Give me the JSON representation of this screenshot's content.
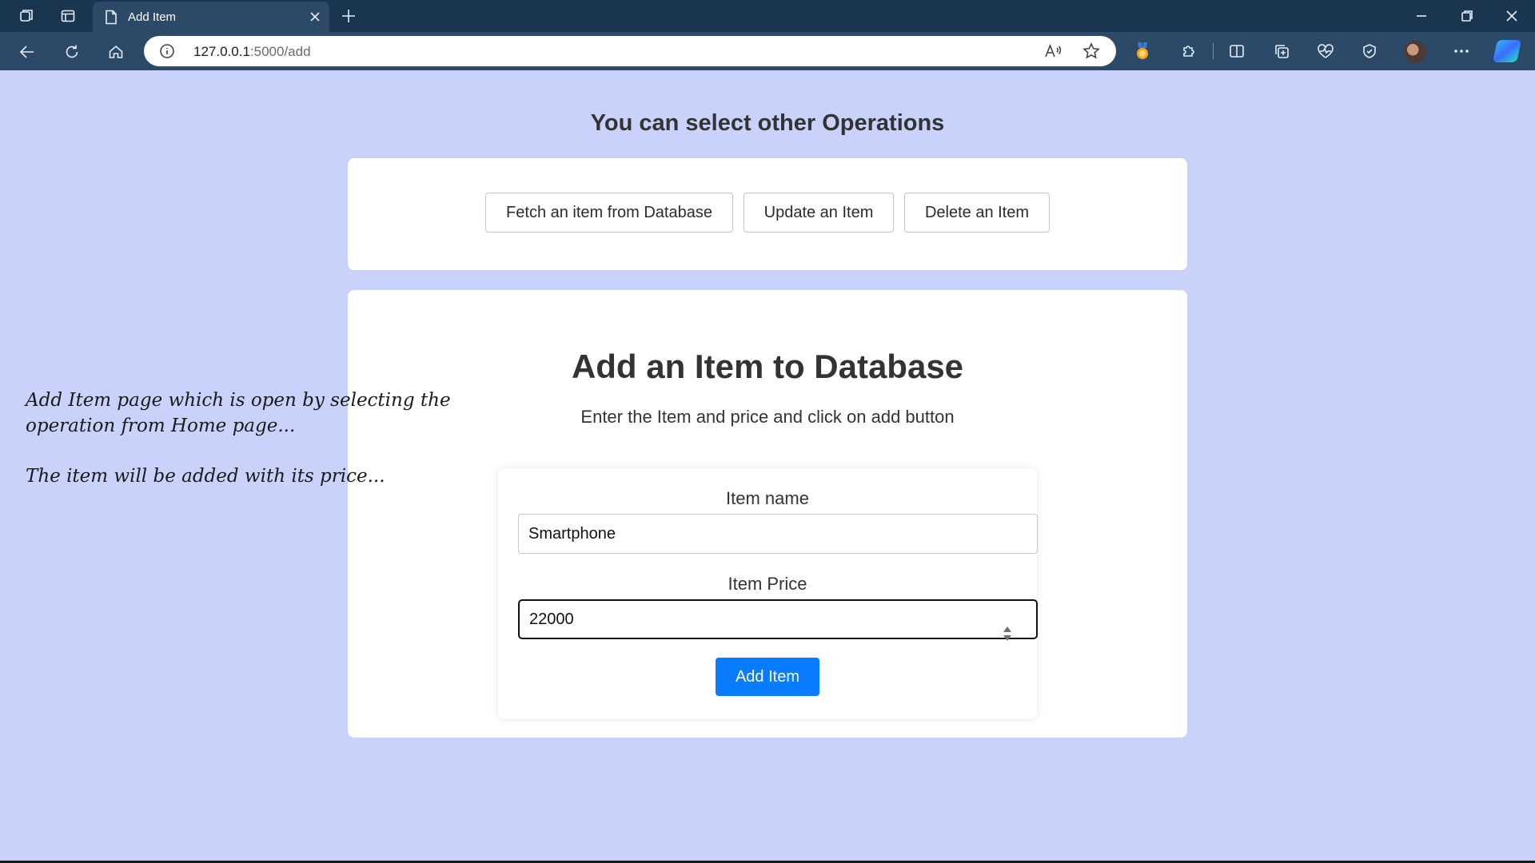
{
  "browser": {
    "tab_title": "Add Item",
    "url_host": "127.0.0.1",
    "url_path": ":5000/add",
    "icons": [
      "workspaces-icon",
      "tab-actions-icon",
      "page-icon",
      "close-tab-icon",
      "new-tab-icon",
      "minimize-icon",
      "restore-icon",
      "close-window-icon",
      "back-icon",
      "refresh-icon",
      "home-icon",
      "site-info-icon",
      "read-aloud-icon",
      "favorite-star-icon",
      "rewards-medal-icon",
      "extensions-icon",
      "split-screen-icon",
      "collections-icon",
      "performance-icon",
      "browser-essentials-icon",
      "profile-avatar",
      "more-menu-icon",
      "copilot-icon"
    ]
  },
  "operations": {
    "heading": "You can select other Operations",
    "buttons": [
      "Fetch an item from Database",
      "Update an Item",
      "Delete an Item"
    ]
  },
  "main": {
    "title": "Add an Item to Database",
    "subtitle": "Enter the Item and price and click on add button",
    "form": {
      "name_label": "Item name",
      "name_value": "Smartphone",
      "price_label": "Item Price",
      "price_value": "22000",
      "submit_label": "Add Item"
    }
  },
  "annotation": {
    "line1": "Add Item page which is open by selecting the",
    "line2": "operation from Home page...",
    "line3": "The item will be added with its price..."
  },
  "colors": {
    "page_background": "#c8d2fb",
    "primary_button": "#0a7cff",
    "browser_frame": "#1a3550"
  }
}
